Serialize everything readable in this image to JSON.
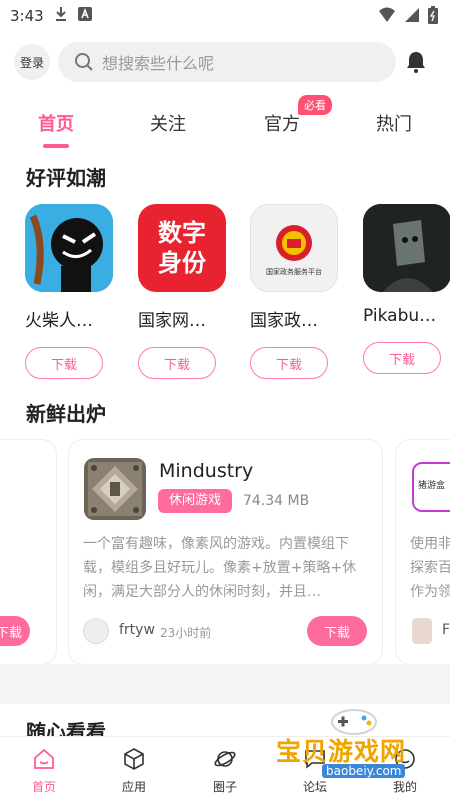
{
  "status": {
    "time": "3:43"
  },
  "header": {
    "login": "登录",
    "search_placeholder": "想搜索些什么呢"
  },
  "tabs": [
    {
      "label": "首页",
      "active": true
    },
    {
      "label": "关注"
    },
    {
      "label": "官方",
      "badge": "必看"
    },
    {
      "label": "热门"
    }
  ],
  "section1": {
    "title": "好评如潮",
    "apps": [
      {
        "name": "火柴人…",
        "download": "下载",
        "icon": "stickman-icon"
      },
      {
        "name": "国家网…",
        "download": "下载",
        "icon": "digital-id-icon",
        "icon_text": "数字身份"
      },
      {
        "name": "国家政…",
        "download": "下载",
        "icon": "gov-emblem-icon",
        "icon_text": "国家政务服务平台"
      },
      {
        "name": "Pikabu…",
        "download": "下载",
        "icon": "pikabu-icon"
      }
    ]
  },
  "section2": {
    "title": "新鲜出炉",
    "left_card": {
      "download": "下载"
    },
    "main_card": {
      "app_name": "Mindustry",
      "tag": "休闲游戏",
      "size": "74.34 MB",
      "description": "一个富有趣味，像素风的游戏。内置模组下载，模组多且好玩儿。像素+放置+策略+休闲，满足大部分人的休闲时刻，并且…",
      "author": "frtyw",
      "time": "23小时前",
      "download": "下载"
    },
    "right_card": {
      "text": "使用非 探索百 作为领",
      "icon_text": "猪游盒",
      "author_initial": "F"
    }
  },
  "section3": {
    "title": "随心看看"
  },
  "bottom_nav": [
    {
      "label": "首页",
      "icon": "home-icon",
      "active": true
    },
    {
      "label": "应用",
      "icon": "cube-icon"
    },
    {
      "label": "圈子",
      "icon": "planet-icon"
    },
    {
      "label": "论坛",
      "icon": "forum-icon"
    },
    {
      "label": "我的",
      "icon": "profile-icon"
    }
  ],
  "watermark": {
    "title": "宝贝游戏网",
    "url": "baobeiy.com"
  },
  "colors": {
    "accent": "#ff5c8d",
    "tag_bg": "#ff6c9c"
  }
}
